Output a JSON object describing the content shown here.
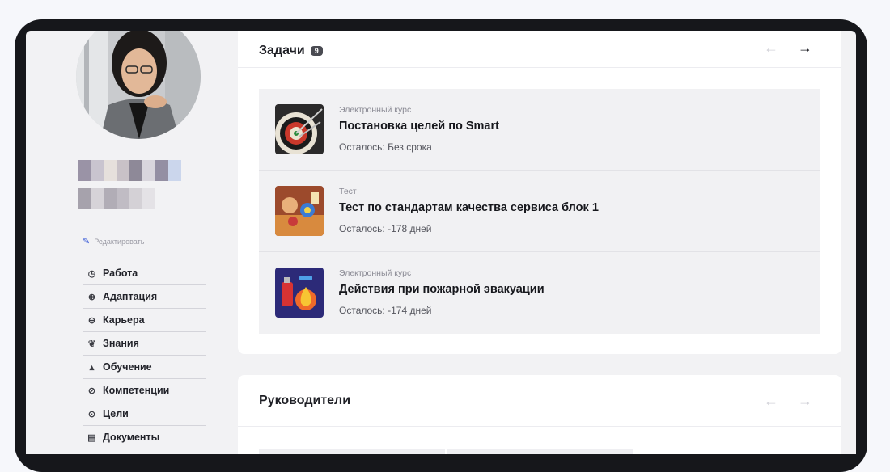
{
  "sidebar": {
    "edit_label": "Редактировать",
    "menu": [
      {
        "label": "Работа",
        "icon": "clock-icon"
      },
      {
        "label": "Адаптация",
        "icon": "globe-icon"
      },
      {
        "label": "Карьера",
        "icon": "briefcase-icon"
      },
      {
        "label": "Знания",
        "icon": "knowledge-icon"
      },
      {
        "label": "Обучение",
        "icon": "graduation-cap-icon"
      },
      {
        "label": "Компетенции",
        "icon": "badge-icon"
      },
      {
        "label": "Цели",
        "icon": "target-icon"
      },
      {
        "label": "Документы",
        "icon": "document-icon"
      }
    ]
  },
  "tasks": {
    "title": "Задачи",
    "count": "9",
    "items": [
      {
        "type": "Электронный курс",
        "title": "Постановка целей по Smart",
        "due": "Осталось: Без срока",
        "thumb": "darts-image"
      },
      {
        "type": "Тест",
        "title": "Тест по стандартам качества сервиса блок 1",
        "due": "Осталось: -178 дней",
        "thumb": "service-quality-image"
      },
      {
        "type": "Электронный курс",
        "title": "Действия при пожарной эвакуации",
        "due": "Осталось: -174 дней",
        "thumb": "fire-safety-image"
      }
    ]
  },
  "managers": {
    "title": "Руководители"
  },
  "colors": {
    "frame": "#16171b",
    "background": "#f2f2f4",
    "card": "#ffffff",
    "task_row": "#f1f1f3",
    "edit_icon": "#3a5bd8"
  }
}
